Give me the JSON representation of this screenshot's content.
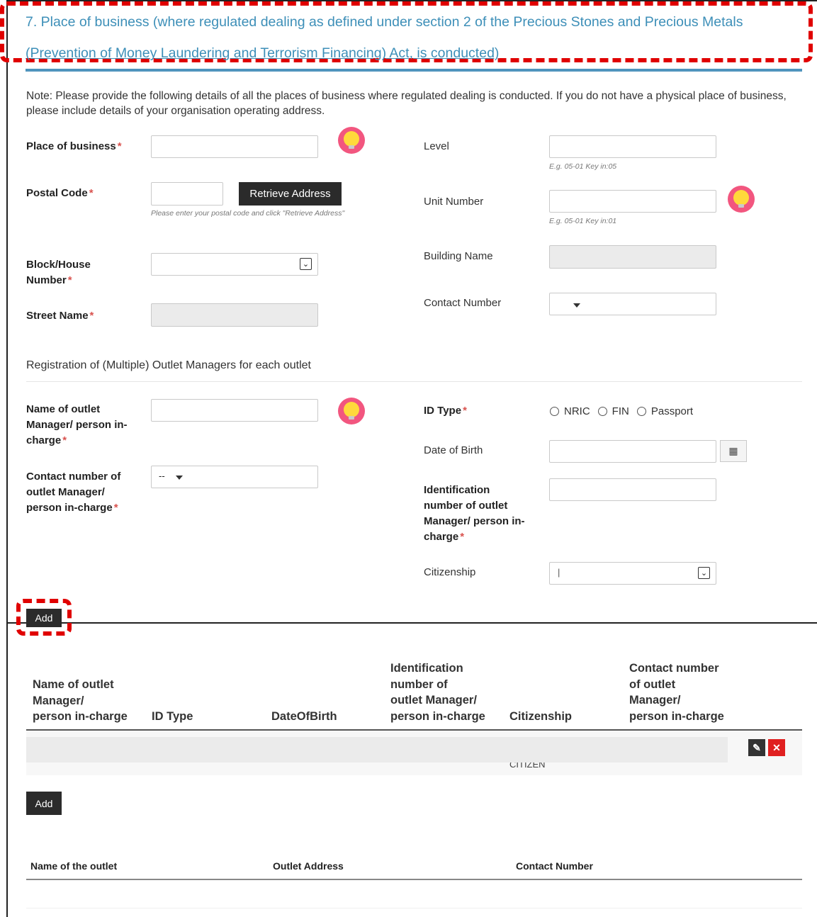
{
  "section": {
    "title_line1": "7. Place of business (where regulated dealing as defined under section 2 of the Precious Stones and Precious Metals",
    "title_line2": "(Prevention of Money Laundering and Terrorism Financing) Act, is conducted)",
    "note": "Note: Please provide the following details of all the places of business where regulated dealing is conducted. If you do not have a physical place of business, please include details of your organisation operating address."
  },
  "form": {
    "place_label": "Place of business",
    "postal_label": "Postal Code",
    "retrieve_label": "Retrieve Address",
    "postal_hint": "Please enter your postal code and click \"Retrieve Address\"",
    "block_label_line1": "Block/House",
    "block_label_line2": "Number",
    "street_label": "Street Name",
    "level_label": "Level",
    "level_hint": "E.g. 05-01 Key in:05",
    "unit_label": "Unit Number",
    "unit_hint": "E.g. 05-01 Key in:01",
    "building_label": "Building Name",
    "contact_label": "Contact Number",
    "required_mark": "*"
  },
  "managers": {
    "subheading": "Registration of (Multiple) Outlet Managers for each outlet",
    "name_label_l1": "Name of outlet",
    "name_label_l2": "Manager/ person in-",
    "name_label_l3": "charge",
    "contact_label_l1": "Contact number of",
    "contact_label_l2": "outlet Manager/",
    "contact_label_l3": "person in-charge",
    "contact_prefix": "--",
    "idtype_label": "ID Type",
    "id_options": [
      "NRIC",
      "FIN",
      "Passport"
    ],
    "dob_label": "Date of Birth",
    "idnum_label_l1": "Identification",
    "idnum_label_l2": "number of outlet",
    "idnum_label_l3": "Manager/ person in-",
    "idnum_label_l4": "charge",
    "citizenship_label": "Citizenship",
    "citizenship_value": "|",
    "add_label": "Add"
  },
  "manager_table": {
    "headers": [
      [
        "Name of outlet",
        "Manager/",
        "person in-charge"
      ],
      [
        "ID Type"
      ],
      [
        "DateOfBirth"
      ],
      [
        "Identification",
        "number of",
        "outlet Manager/",
        "person in-charge"
      ],
      [
        "Citizenship"
      ],
      [
        "Contact number",
        "of outlet",
        "Manager/",
        "person in-charge"
      ]
    ],
    "row_partial_text": "CITIZEN"
  },
  "outlet": {
    "add_label": "Add",
    "headers": [
      "Name of the outlet",
      "Outlet Address",
      "Contact Number"
    ]
  },
  "colors": {
    "title": "#3d8fb8",
    "required": "#d9534f",
    "annotation": "#e00000",
    "dark_button": "#2b2b2b",
    "delete": "#e02020"
  },
  "icons": [
    "lightbulb-icon",
    "calendar-icon",
    "edit-icon",
    "delete-icon",
    "chevron-down-icon"
  ]
}
